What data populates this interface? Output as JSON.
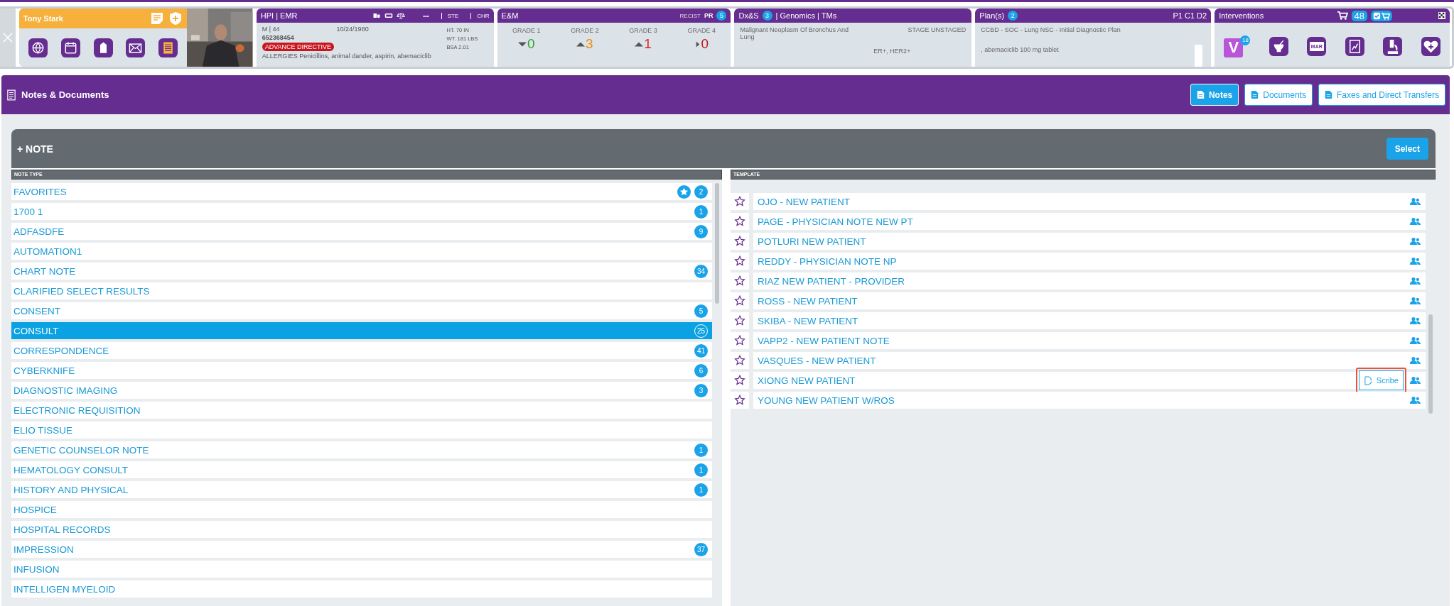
{
  "patient": {
    "name": "Tony Stark"
  },
  "hpi": {
    "title": "HPI | EMR",
    "more": "•••",
    "tabs": [
      "STE",
      "CHR"
    ],
    "sex_age": "M | 44",
    "dob": "10/24/1980",
    "mrn": "652368454",
    "directive": "ADVANCE DIRECTIVE",
    "vitals": [
      "HT. 70 IN",
      "WT. 181 LBS",
      "BSA 2.01"
    ],
    "allergies": "ALLERGIES Penicillins, animal dander, aspirin, abemaciclib"
  },
  "em": {
    "title": "E&M",
    "recist_label": "RECIST",
    "recist": "PR",
    "count": "5",
    "grades": [
      {
        "label": "GRADE 1",
        "kind": "down",
        "value": "0",
        "color": "#2ca42c"
      },
      {
        "label": "GRADE 2",
        "kind": "up",
        "value": "3",
        "color": "#f08c10"
      },
      {
        "label": "GRADE 3",
        "kind": "up",
        "value": "1",
        "color": "#e02828"
      },
      {
        "label": "GRADE 4",
        "kind": "right",
        "value": "0",
        "color": "#c01818"
      }
    ]
  },
  "dx": {
    "title": "Dx&S",
    "count": "3",
    "links": "| Genomics | TMs",
    "diagnosis": "Malignant Neoplasm Of Bronchus And Lung",
    "stage": "STAGE UNSTAGED",
    "markers": "ER+, HER2+"
  },
  "plan": {
    "title": "Plan(s)",
    "count": "2",
    "cycle": "P1 C1 D2",
    "lines": [
      "CCBD - SOC - Lung NSC - Initial Diagnostic Plan",
      ", abemaciclib 100 mg tablet"
    ]
  },
  "interventions": {
    "title": "Interventions",
    "cart_count": "48",
    "v_label": "V",
    "v_count": "18",
    "mar_label": "MAR"
  },
  "notes": {
    "title": "Notes & Documents",
    "views": [
      {
        "label": "Notes",
        "selected": true
      },
      {
        "label": "Documents",
        "selected": false
      },
      {
        "label": "Faxes and Direct Transfers",
        "selected": false
      }
    ],
    "add": "+ NOTE",
    "select": "Select",
    "note_type_header": "NOTE TYPE",
    "template_header": "TEMPLATE",
    "note_types": [
      {
        "label": "FAVORITES",
        "count": "2",
        "kind": "favorites",
        "selected": false
      },
      {
        "label": "1700 1",
        "count": "1",
        "kind": "type",
        "selected": false
      },
      {
        "label": "ADFASDFE",
        "count": "9",
        "kind": "type",
        "selected": false
      },
      {
        "label": "AUTOMATION1",
        "kind": "type",
        "selected": false
      },
      {
        "label": "CHART NOTE",
        "count": "34",
        "kind": "type",
        "selected": false
      },
      {
        "label": "CLARIFIED SELECT RESULTS",
        "kind": "type",
        "selected": false
      },
      {
        "label": "CONSENT",
        "count": "5",
        "kind": "type",
        "selected": false
      },
      {
        "label": "CONSULT",
        "count": "25",
        "kind": "type",
        "selected": true
      },
      {
        "label": "CORRESPONDENCE",
        "count": "41",
        "kind": "type",
        "selected": false
      },
      {
        "label": "CYBERKNIFE",
        "count": "6",
        "kind": "type",
        "selected": false
      },
      {
        "label": "DIAGNOSTIC IMAGING",
        "count": "3",
        "kind": "type",
        "selected": false
      },
      {
        "label": "ELECTRONIC REQUISITION",
        "kind": "type",
        "selected": false
      },
      {
        "label": "ELIO TISSUE",
        "kind": "type",
        "selected": false
      },
      {
        "label": "GENETIC COUNSELOR NOTE",
        "count": "1",
        "kind": "type",
        "selected": false
      },
      {
        "label": "HEMATOLOGY CONSULT",
        "count": "1",
        "kind": "type",
        "selected": false
      },
      {
        "label": "HISTORY AND PHYSICAL",
        "count": "1",
        "kind": "type",
        "selected": false
      },
      {
        "label": "HOSPICE",
        "kind": "type",
        "selected": false
      },
      {
        "label": "HOSPITAL RECORDS",
        "kind": "type",
        "selected": false
      },
      {
        "label": "IMPRESSION",
        "count": "37",
        "kind": "type",
        "selected": false
      },
      {
        "label": "INFUSION",
        "kind": "type",
        "selected": false
      },
      {
        "label": "INTELLIGEN MYELOID",
        "kind": "type",
        "selected": false
      }
    ],
    "templates": [
      {
        "label": "OJO - NEW PATIENT"
      },
      {
        "label": "PAGE - PHYSICIAN NOTE NEW PT"
      },
      {
        "label": "POTLURI NEW PATIENT"
      },
      {
        "label": "REDDY - PHYSICIAN NOTE NP"
      },
      {
        "label": "RIAZ NEW PATIENT - PROVIDER"
      },
      {
        "label": "ROSS - NEW PATIENT"
      },
      {
        "label": "SKIBA - NEW PATIENT"
      },
      {
        "label": "VAPP2 - NEW PATIENT NOTE"
      },
      {
        "label": "VASQUES - NEW PATIENT"
      },
      {
        "label": "XIONG NEW PATIENT",
        "action": "Scribe"
      },
      {
        "label": "YOUNG NEW PATIENT W/ROS"
      }
    ]
  }
}
